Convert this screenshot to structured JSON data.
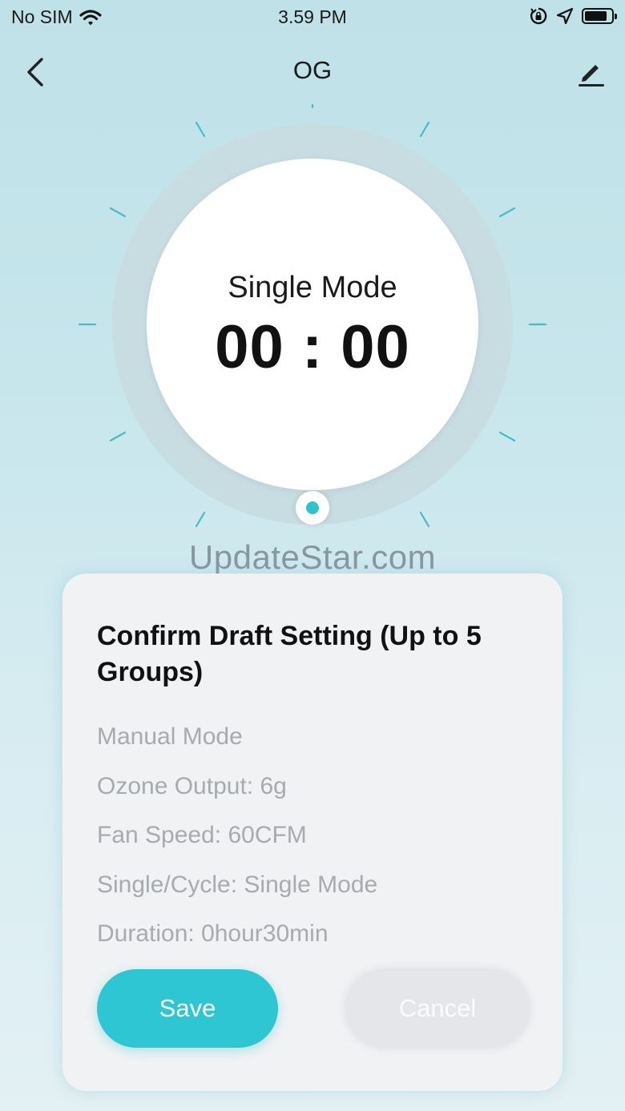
{
  "status_bar": {
    "carrier": "No SIM",
    "time": "3.59 PM",
    "battery_level": 0.85,
    "icons": [
      "wifi-icon",
      "orientation-lock-icon",
      "location-arrow-icon",
      "battery-icon"
    ]
  },
  "nav": {
    "title": "OG",
    "icons": [
      "chevron-left-icon",
      "edit-pencil-icon"
    ]
  },
  "dial": {
    "mode": "Single Mode",
    "time": "00 : 00",
    "accent": "#2fc3cd"
  },
  "watermark": "UpdateStar.com",
  "dialog": {
    "title": "Confirm Draft Setting (Up to 5 Groups)",
    "lines": [
      "Manual Mode",
      "Ozone Output: 6g",
      "Fan Speed: 60CFM",
      "Single/Cycle: Single Mode",
      "Duration: 0hour30min"
    ],
    "save_label": "Save",
    "cancel_label": "Cancel",
    "save_color": "#2ec6d2"
  }
}
